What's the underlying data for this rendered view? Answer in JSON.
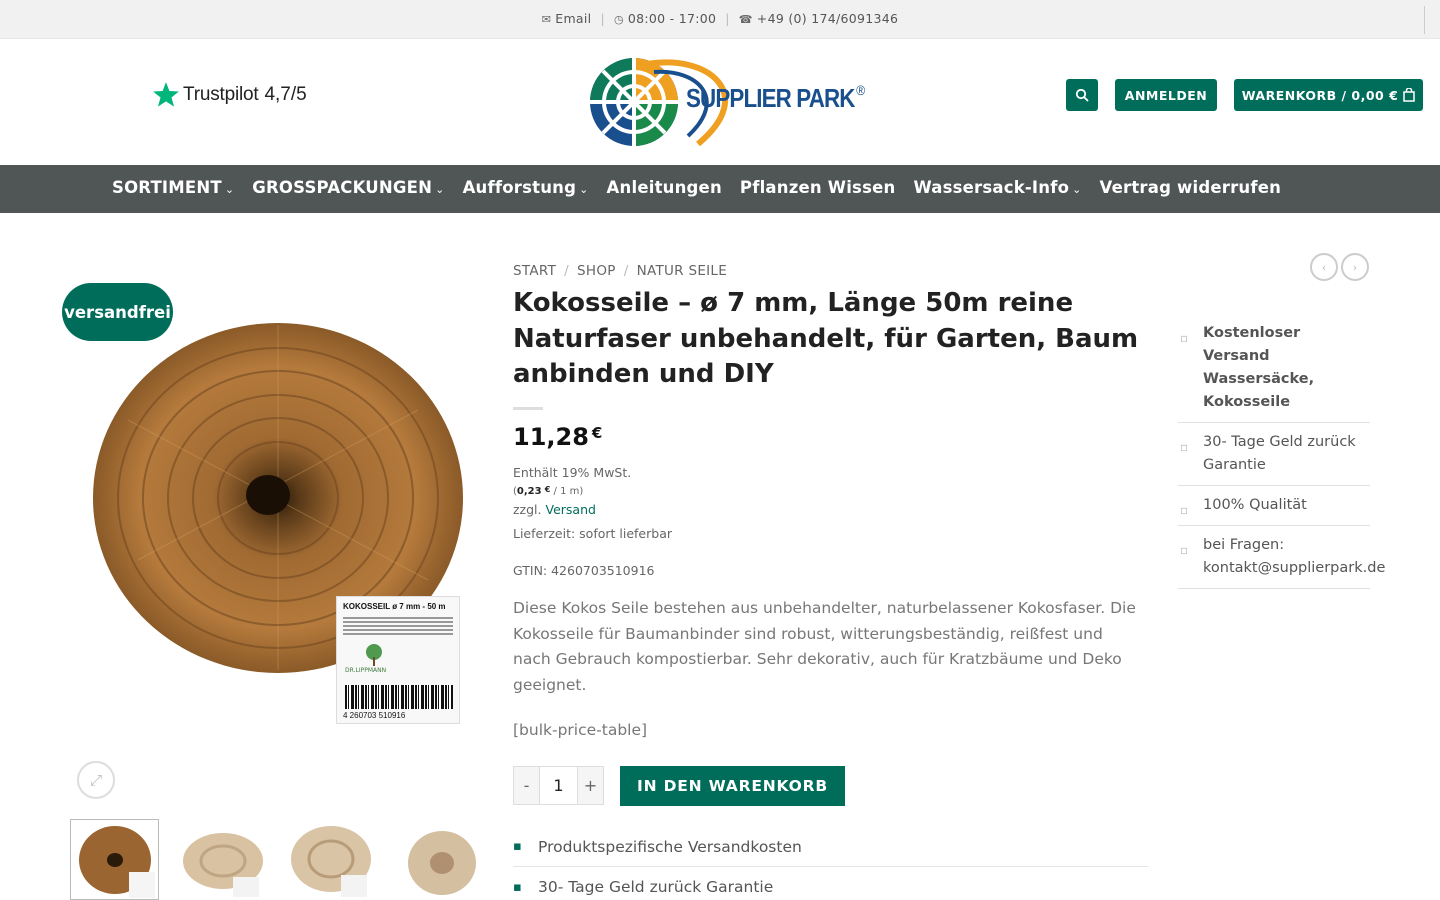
{
  "topbar": {
    "email": "Email",
    "hours": "08:00 - 17:00",
    "phone": "+49 (0) 174/6091346",
    "email_icon": "envelope-icon",
    "hours_icon": "clock-icon",
    "phone_icon": "phone-icon"
  },
  "header": {
    "trustpilot_name": "Trustpilot",
    "trustpilot_score": "4,7/5",
    "logo_text": "SUPPLIER PARK",
    "logo_reg": "®",
    "search_icon": "search-icon",
    "login_label": "ANMELDEN",
    "cart_label": "WARENKORB / 0,00 €",
    "cart_icon": "shopping-bag-icon",
    "colors": {
      "accent": "#006d5b",
      "nav": "#505555",
      "logo_blue": "#1a4f8e",
      "logo_orange": "#f0a020"
    }
  },
  "nav": {
    "items": [
      {
        "label": "SORTIMENT",
        "has_chevron": true
      },
      {
        "label": "GROSSPACKUNGEN",
        "has_chevron": true
      },
      {
        "label": "Aufforstung",
        "has_chevron": true
      },
      {
        "label": "Anleitungen",
        "has_chevron": false
      },
      {
        "label": "Pflanzen Wissen",
        "has_chevron": false
      },
      {
        "label": "Wassersack-Info",
        "has_chevron": true
      },
      {
        "label": "Vertrag widerrufen",
        "has_chevron": false
      }
    ]
  },
  "gallery": {
    "badge": "versandfrei",
    "label_title": "KOKOSSEIL ø 7 mm - 50 m",
    "label_brand": "DR.LIPPMANN",
    "barcode_number": "4   260703   510916",
    "zoom_icon": "zoom-icon"
  },
  "product": {
    "breadcrumb": [
      "START",
      "SHOP",
      "NATUR SEILE"
    ],
    "title": "Kokosseile – ø 7 mm, Länge 50m reine Naturfaser unbehandelt, für Garten, Baum anbinden und DIY",
    "price": "11,28",
    "currency": "€",
    "vat": "Enthält 19% MwSt.",
    "unit_open": "(",
    "unit_price": "0,23",
    "unit_currency": "€",
    "unit_rest": " / 1 m)",
    "shipping_prefix": "zzgl. ",
    "shipping_link": "Versand",
    "delivery": "Lieferzeit: sofort lieferbar",
    "gtin": "GTIN: 4260703510916",
    "description": "Diese Kokos Seile bestehen aus unbehandelter, naturbelassener Kokosfaser. Die Kokosseile für Baumanbinder sind robust, witterungsbeständig, reißfest und nach Gebrauch kompostierbar. Sehr dekorativ, auch für Kratzbäume und Deko geeignet.",
    "bulk_shortcode": "[bulk-price-table]",
    "qty_minus": "-",
    "qty_value": "1",
    "qty_plus": "+",
    "add_to_cart": "IN DEN WARENKORB",
    "features": [
      "Produktspezifische Versandkosten",
      "30- Tage Geld zurück Garantie"
    ]
  },
  "sidebar": {
    "items": [
      "Kostenloser Versand Wassersäcke, Kokosseile",
      "30- Tage Geld zurück Garantie",
      "100% Qualität",
      "bei Fragen: kontakt@supplierpark.de"
    ]
  }
}
